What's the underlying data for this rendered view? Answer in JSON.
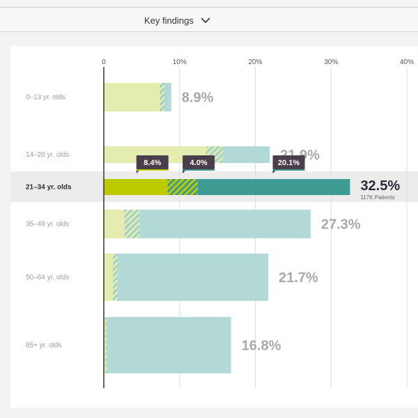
{
  "header": {
    "dropdown_label": "Key findings",
    "dropdown_icon": "chevron-down-icon"
  },
  "colors": {
    "light_green": "#e4ecb0",
    "light_teal": "#b2d9d6",
    "green": "#bcca00",
    "teal": "#3d9b93",
    "tag_bg": "#4a3e4a",
    "highlight_bg": "#ececec",
    "muted_text": "#9a9a9a",
    "dark_text": "#2b2b38"
  },
  "chart_data": {
    "type": "bar",
    "stacked": true,
    "orientation": "horizontal",
    "xlim": [
      0,
      40
    ],
    "xticks": [
      "0",
      "10%",
      "20%",
      "30%",
      "40%"
    ],
    "xtick_values": [
      0,
      10,
      20,
      30,
      40
    ],
    "grid": true,
    "categories": [
      "0–13 yr. olds",
      "14–20 yr. olds",
      "21–34 yr. olds",
      "35–49 yr. olds",
      "50–64 yr. olds",
      "65+ yr. olds"
    ],
    "highlight_index": 2,
    "series": [
      {
        "key": "s1",
        "values": [
          7.4,
          13.5,
          8.4,
          2.7,
          1.2,
          0.2
        ]
      },
      {
        "key": "s2",
        "values": [
          0.6,
          2.2,
          4.0,
          2.0,
          0.6,
          0.2
        ]
      },
      {
        "key": "s3",
        "values": [
          0.9,
          6.2,
          20.1,
          22.6,
          19.9,
          16.4
        ]
      }
    ],
    "totals": [
      "8.9%",
      "21.9%",
      "32.5%",
      "27.3%",
      "21.7%",
      "16.8%"
    ],
    "highlight_sublabel": "117K Patients",
    "callouts": [
      "8.4%",
      "4.0%",
      "20.1%"
    ]
  }
}
